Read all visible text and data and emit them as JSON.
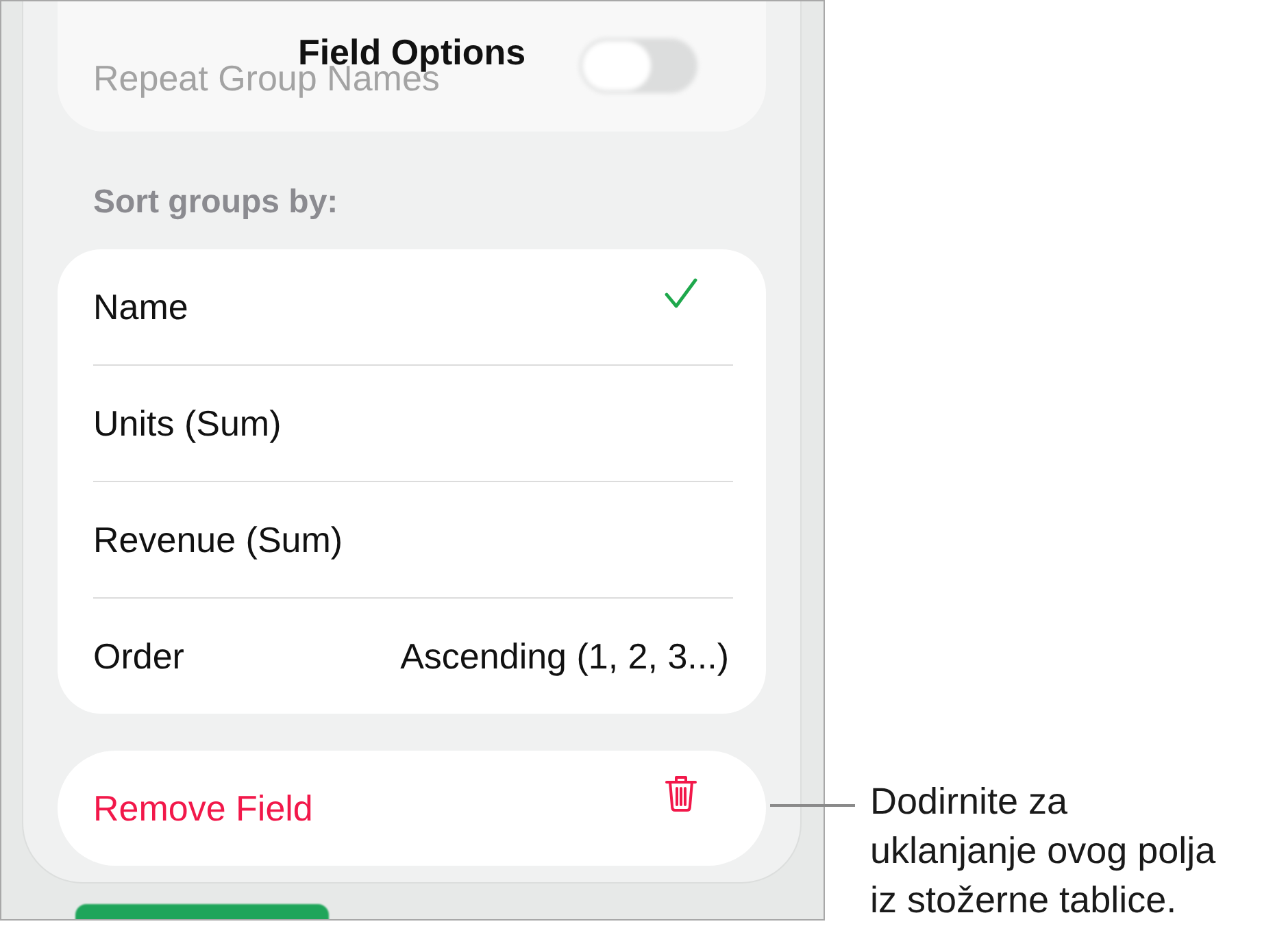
{
  "title": "Field Options",
  "repeat_group_names": {
    "label": "Repeat Group Names",
    "on": false
  },
  "section_label": "Sort groups by:",
  "sort_options": [
    {
      "label": "Name",
      "selected": true
    },
    {
      "label": "Units (Sum)",
      "selected": false
    },
    {
      "label": "Revenue (Sum)",
      "selected": false
    }
  ],
  "order": {
    "label": "Order",
    "value": "Ascending (1, 2, 3...)"
  },
  "remove_button": {
    "label": "Remove Field"
  },
  "callout": "Dodirnite za uklanjanje ovog polja iz stožerne tablice."
}
